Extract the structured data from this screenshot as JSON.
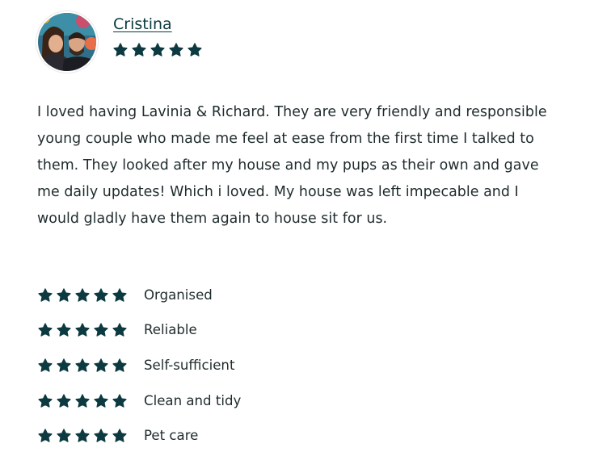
{
  "reviewer": {
    "name": "Cristina",
    "overall_rating": 5,
    "max_rating": 5
  },
  "review": {
    "text": "I loved having Lavinia & Richard. They are very friendly and responsible young couple who made me feel at ease from the first time I talked to them. They looked after my house and my pups as their own and gave me daily updates! Which i loved. My house was left impecable and I would gladly have them again to house sit for us."
  },
  "ratings": [
    {
      "label": "Organised",
      "stars": 5
    },
    {
      "label": "Reliable",
      "stars": 5
    },
    {
      "label": "Self-sufficient",
      "stars": 5
    },
    {
      "label": "Clean and tidy",
      "stars": 5
    },
    {
      "label": "Pet care",
      "stars": 5
    }
  ],
  "colors": {
    "star": "#0c3a40",
    "text": "#1f2b2d",
    "name": "#0c3a40"
  },
  "icons": {
    "star": "star-icon",
    "avatar": "reviewer-photo"
  }
}
